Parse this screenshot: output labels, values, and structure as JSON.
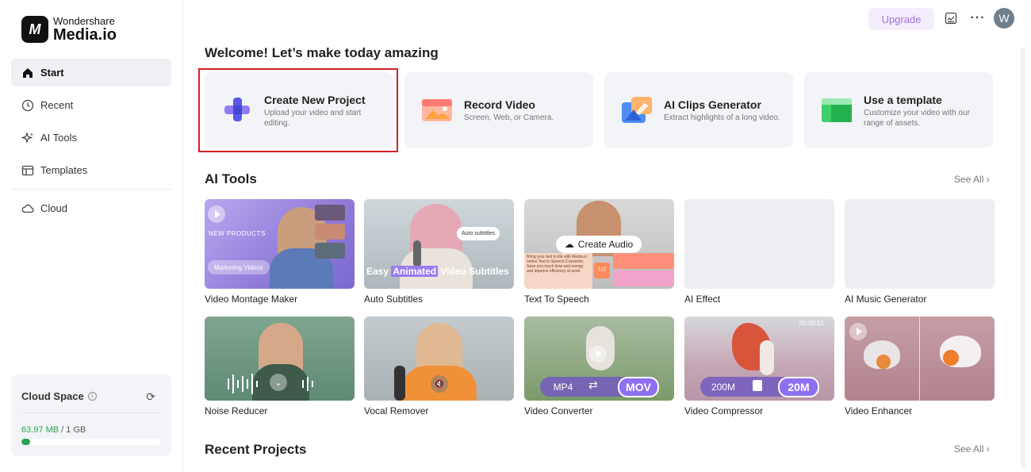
{
  "brand": {
    "line1": "Wondershare",
    "line2": "Media.io"
  },
  "sidebar": {
    "items": [
      {
        "label": "Start"
      },
      {
        "label": "Recent"
      },
      {
        "label": "AI Tools"
      },
      {
        "label": "Templates"
      },
      {
        "label": "Cloud"
      }
    ]
  },
  "cloud_space": {
    "title": "Cloud Space",
    "used": "63.97 MB",
    "separator": " / ",
    "total": "1 GB",
    "usage_fraction": 0.06
  },
  "topbar": {
    "upgrade_label": "Upgrade",
    "avatar_letter": "W"
  },
  "welcome": "Welcome! Let’s make today amazing",
  "quick_actions": [
    {
      "title": "Create New Project",
      "desc": "Upload your video and start editing."
    },
    {
      "title": "Record Video",
      "desc": "Screen, Web, or Camera."
    },
    {
      "title": "AI Clips Generator",
      "desc": "Extract highlights of a long video."
    },
    {
      "title": "Use a template",
      "desc": "Customize your video with our range of assets."
    }
  ],
  "ai_tools": {
    "title": "AI Tools",
    "see_all": "See All",
    "row1": [
      {
        "label": "Video Montage Maker",
        "overlay1": "NEW PRODUCTS",
        "overlay2": "Marketing Videos"
      },
      {
        "label": "Auto Subtitles",
        "overlay1": "Auto subtitles",
        "overlay2a": "Easy ",
        "overlay2b": "Animated",
        "overlay2c": " Video Subtitles"
      },
      {
        "label": "Text To Speech",
        "overlay1": "Create Audio",
        "overlay2": "Bring your text to life with Media.io online Text to Speech Converter. Save you much time and energy and improve efficiency at work.",
        "overlay3": "TXT"
      },
      {
        "label": "AI Effect"
      },
      {
        "label": "AI Music Generator"
      }
    ],
    "row2": [
      {
        "label": "Noise Reducer"
      },
      {
        "label": "Vocal Remover"
      },
      {
        "label": "Video Converter",
        "from": "MP4",
        "to": "MOV"
      },
      {
        "label": "Video Compressor",
        "time": "00:00:51",
        "from": "200M",
        "to": "20M"
      },
      {
        "label": "Video Enhancer"
      }
    ]
  },
  "recent_projects": {
    "title": "Recent Projects",
    "see_all": "See All"
  },
  "colors": {
    "accent": "#a070dc",
    "highlight_border": "#d51f26",
    "usage_green": "#2aa44f"
  }
}
